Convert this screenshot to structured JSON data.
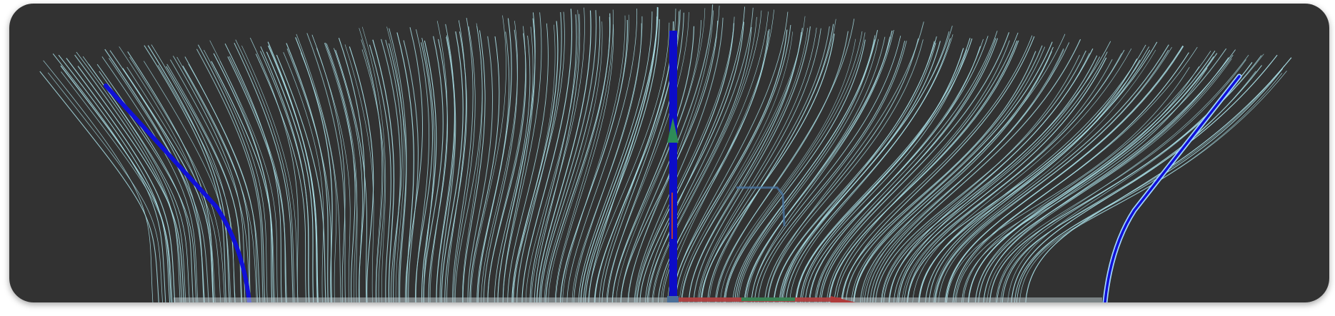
{
  "viewport": {
    "label": "",
    "background_color": "#323232"
  },
  "strands": {
    "color": "#a8dde4",
    "guide_color": "#1010d8",
    "guide_outline_color": "#9fd4ff"
  },
  "axis_gizmo": {
    "y_axis_color": "#2e8b57",
    "z_axis_color": "#0c0cc8",
    "x_axis_color": "#b03a3a",
    "rotate_handle_color": "#4a78a8"
  }
}
